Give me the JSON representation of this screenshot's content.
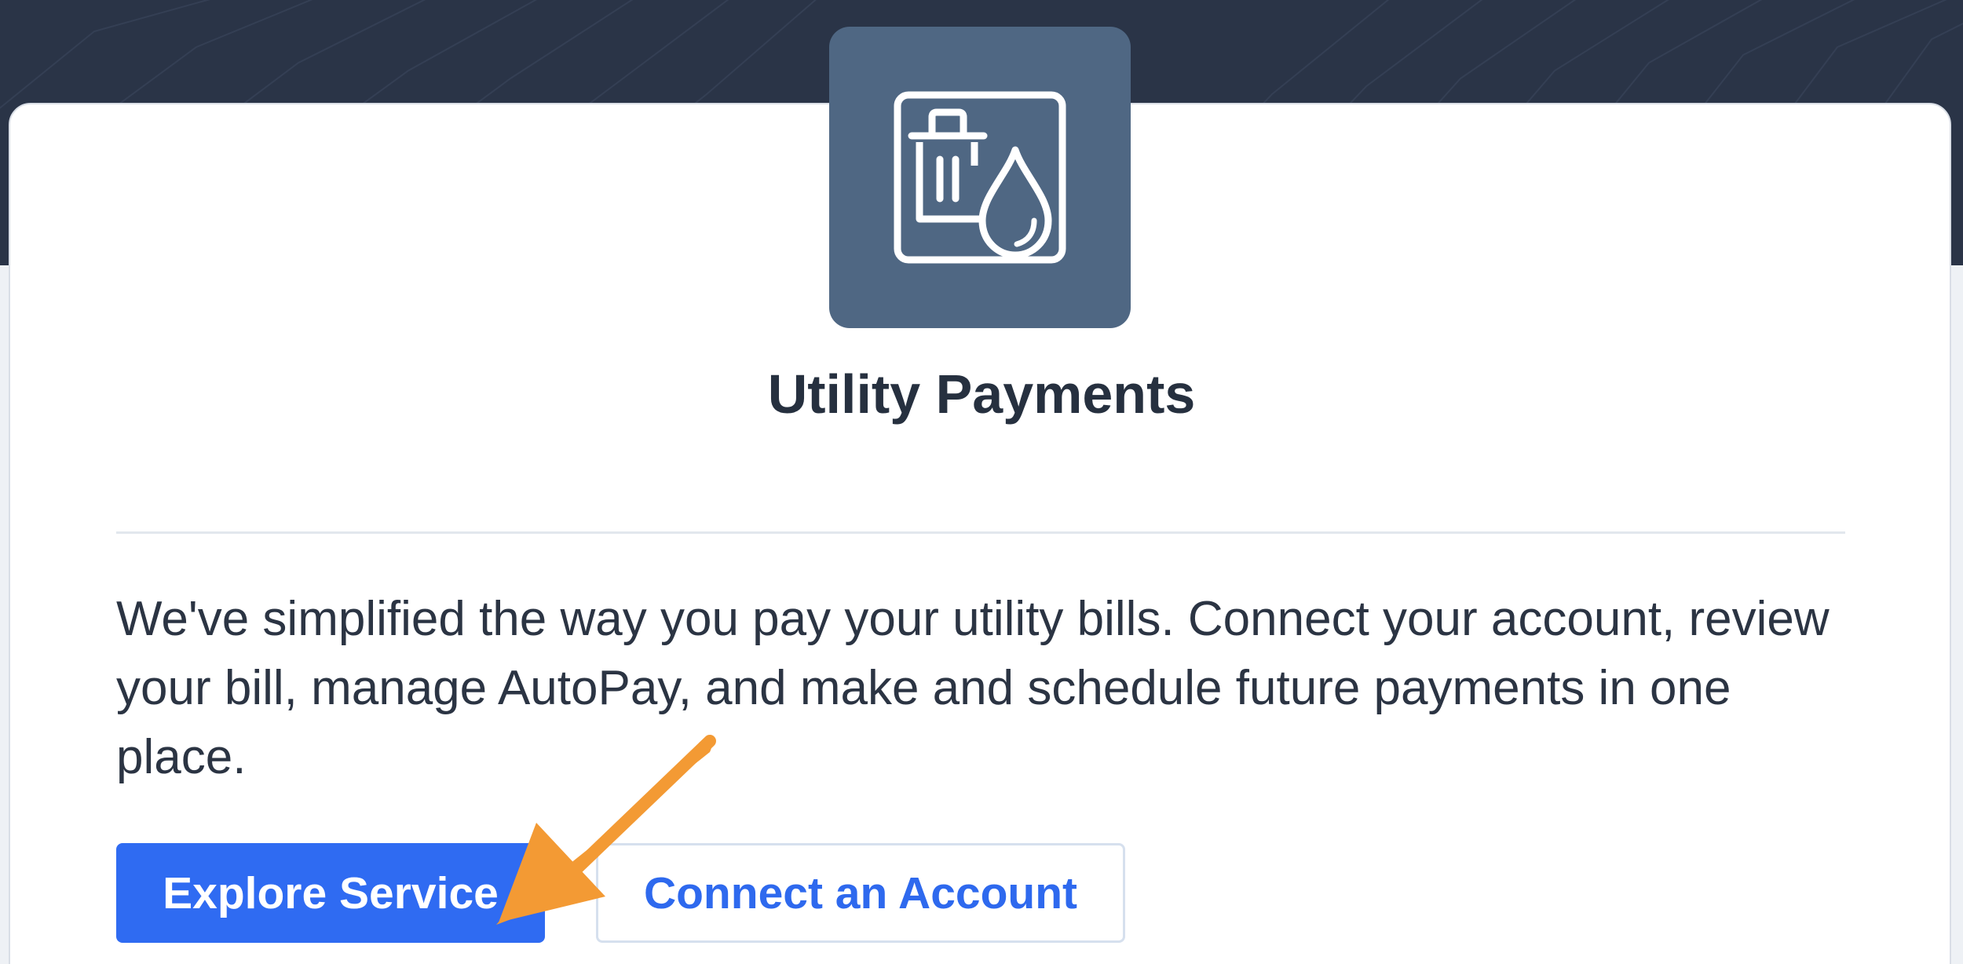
{
  "service": {
    "icon": "trash-water-drop-icon",
    "title": "Utility Payments",
    "description": "We've simplified the way you pay your utility bills. Connect your account, review your bill, manage AutoPay, and make and schedule future payments in one place."
  },
  "actions": {
    "explore_label": "Explore Service",
    "connect_label": "Connect an Account"
  },
  "colors": {
    "header_background": "#2a3447",
    "icon_tile": "#4f6783",
    "primary_button": "#2f6bf2",
    "secondary_text": "#2e69ee",
    "annotation_arrow": "#f39a34"
  }
}
